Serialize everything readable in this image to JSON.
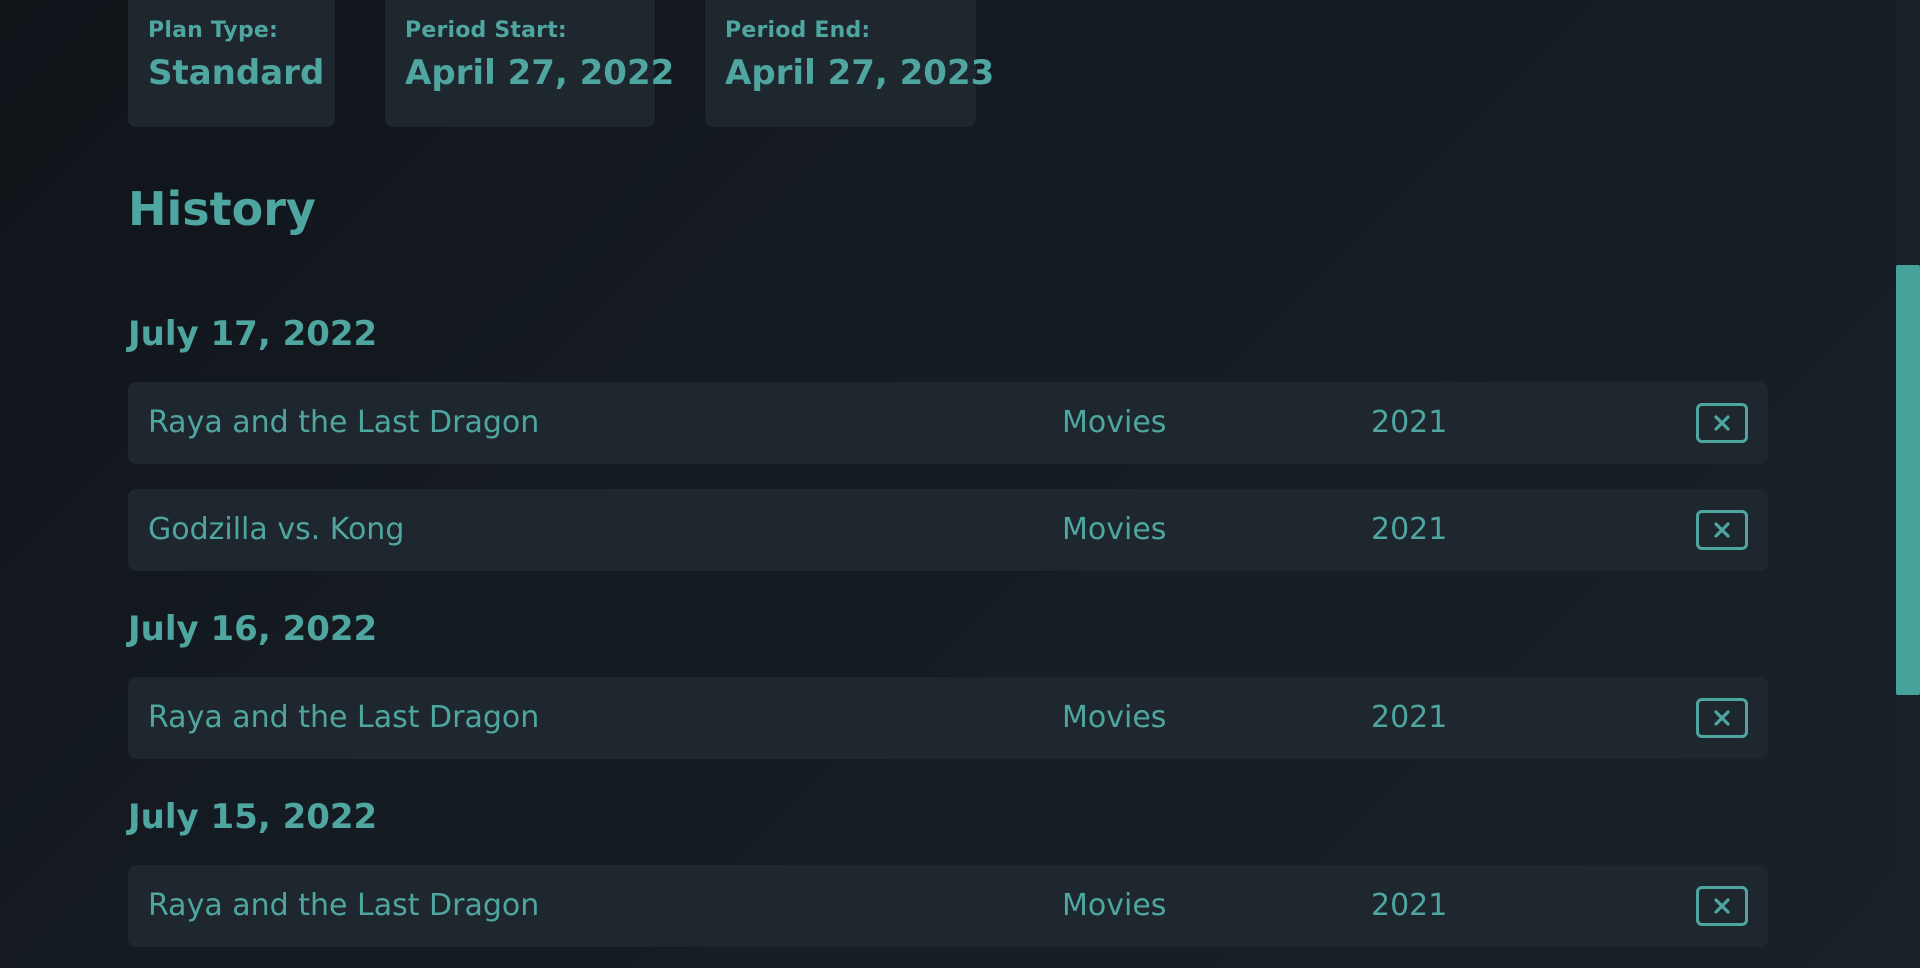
{
  "plan": {
    "type_label": "Plan Type:",
    "type_value": "Standard",
    "start_label": "Period Start:",
    "start_value": "April 27, 2022",
    "end_label": "Period End:",
    "end_value": "April 27, 2023"
  },
  "history": {
    "title": "History",
    "groups": [
      {
        "date": "July 17, 2022",
        "items": [
          {
            "title": "Raya and the Last Dragon",
            "category": "Movies",
            "year": "2021"
          },
          {
            "title": "Godzilla vs. Kong",
            "category": "Movies",
            "year": "2021"
          }
        ]
      },
      {
        "date": "July 16, 2022",
        "items": [
          {
            "title": "Raya and the Last Dragon",
            "category": "Movies",
            "year": "2021"
          }
        ]
      },
      {
        "date": "July 15, 2022",
        "items": [
          {
            "title": "Raya and the Last Dragon",
            "category": "Movies",
            "year": "2021"
          }
        ]
      }
    ]
  },
  "icons": {
    "remove": "close-icon"
  },
  "colors": {
    "accent": "#4fa6a0",
    "card_bg": "#1e262e",
    "page_bg": "#151b22"
  }
}
